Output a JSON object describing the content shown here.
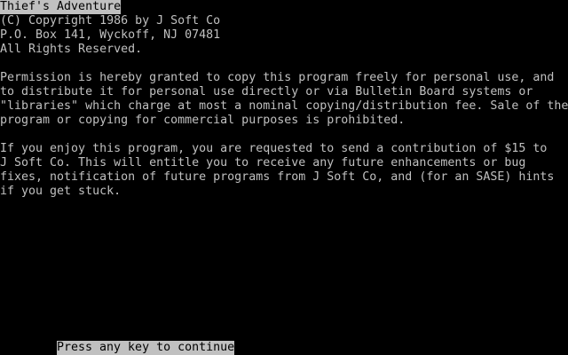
{
  "screen": {
    "title": "Thief's Adventure",
    "copyright_lines": [
      "(C) Copyright 1986 by J Soft Co",
      "P.O. Box 141, Wyckoff, NJ 07481",
      "All Rights Reserved."
    ],
    "permission_paragraph": [
      "Permission is hereby granted to copy this program freely for personal use, and",
      "to distribute it for personal use directly or via Bulletin Board systems or",
      "\"libraries\" which charge at most a nominal copying/distribution fee. Sale of the",
      "program or copying for commercial purposes is prohibited."
    ],
    "contribution_paragraph": [
      "If you enjoy this program, you are requested to send a contribution of $15 to",
      "J Soft Co. This will entitle you to receive any future enhancements or bug",
      "fixes, notification of future programs from J Soft Co, and (for an SASE) hints",
      "if you get stuck."
    ],
    "prompt": "Press any key to continue"
  },
  "colors": {
    "background": "#000000",
    "foreground": "#c0c0c0"
  }
}
